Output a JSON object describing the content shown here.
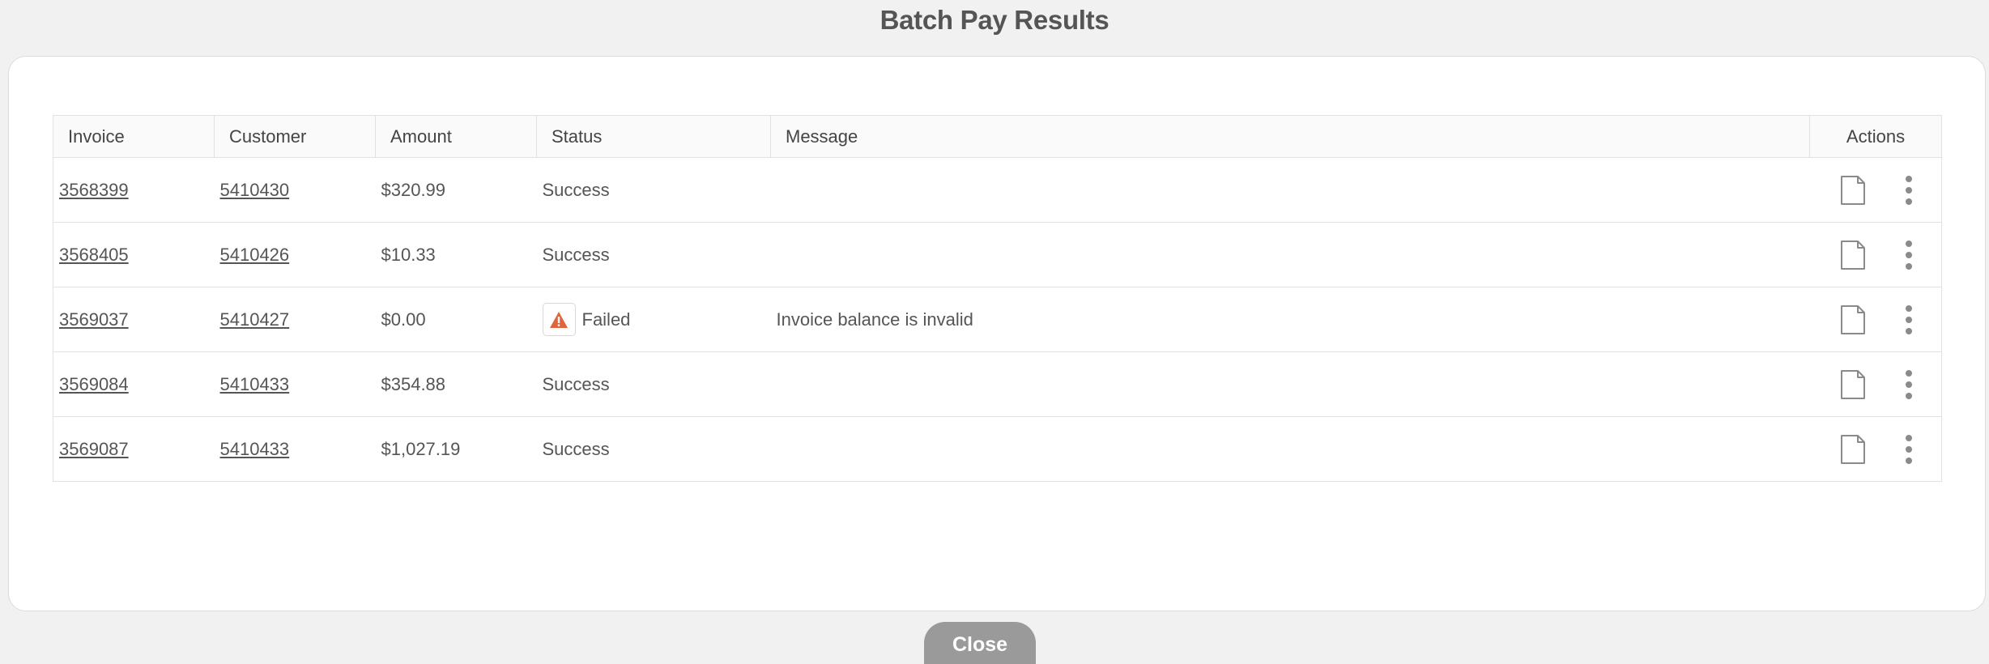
{
  "dialog": {
    "title": "Batch Pay Results",
    "close_label": "Close"
  },
  "table": {
    "headers": {
      "invoice": "Invoice",
      "customer": "Customer",
      "amount": "Amount",
      "status": "Status",
      "message": "Message",
      "actions": "Actions"
    },
    "rows": [
      {
        "invoice": "3568399",
        "customer": "5410430",
        "amount": "$320.99",
        "status": "Success",
        "message": "",
        "warning": false
      },
      {
        "invoice": "3568405",
        "customer": "5410426",
        "amount": "$10.33",
        "status": "Success",
        "message": "",
        "warning": false
      },
      {
        "invoice": "3569037",
        "customer": "5410427",
        "amount": "$0.00",
        "status": "Failed",
        "message": "Invoice balance is invalid",
        "warning": true
      },
      {
        "invoice": "3569084",
        "customer": "5410433",
        "amount": "$354.88",
        "status": "Success",
        "message": "",
        "warning": false
      },
      {
        "invoice": "3569087",
        "customer": "5410433",
        "amount": "$1,027.19",
        "status": "Success",
        "message": "",
        "warning": false
      }
    ]
  },
  "icons": {
    "warning": "warning-triangle-icon",
    "document": "document-icon",
    "more": "more-vertical-icon"
  },
  "colors": {
    "warning": "#e0643c",
    "close_button": "#9a9a9a",
    "icon_gray": "#8a8a8a"
  }
}
